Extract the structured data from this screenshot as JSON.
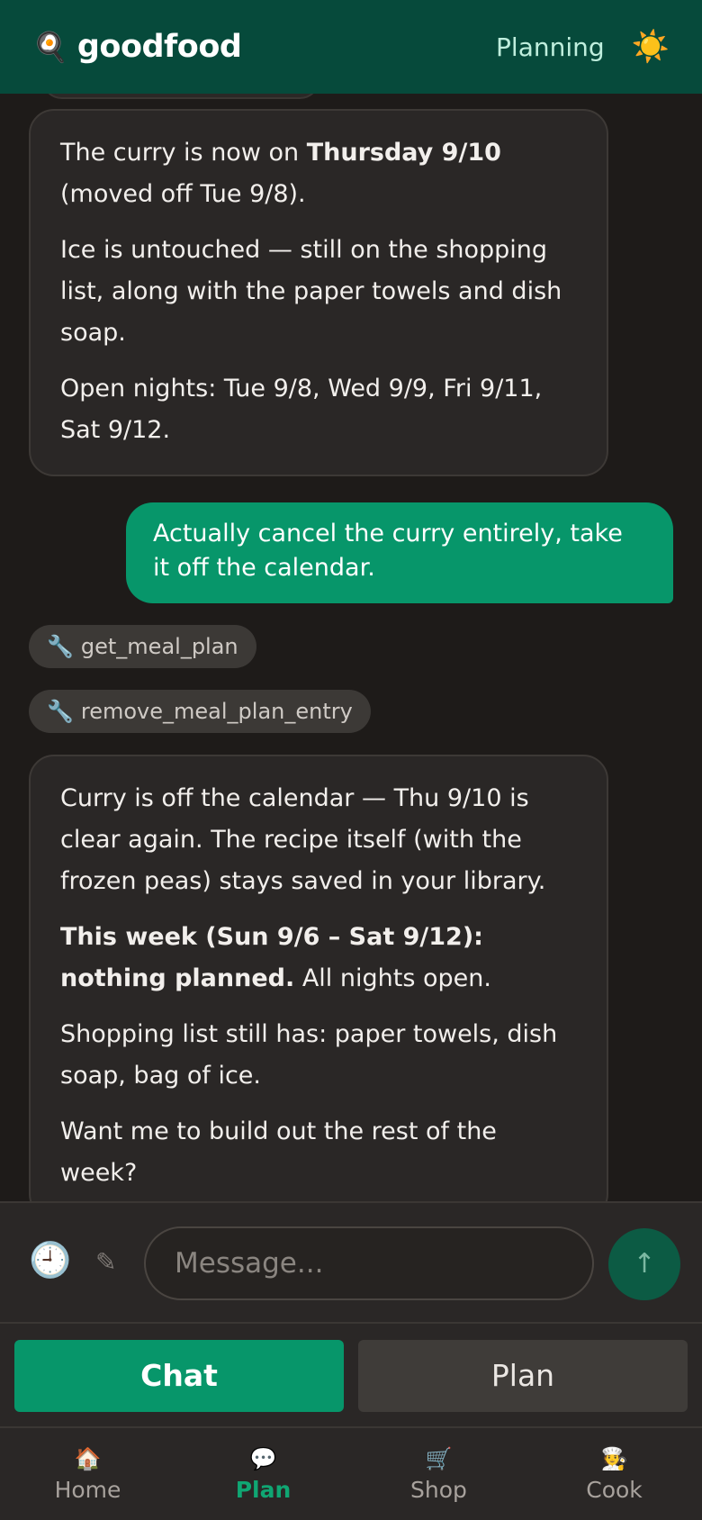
{
  "header": {
    "logo_icon": "🍳",
    "app_name": "goodfood",
    "planning_label": "Planning",
    "theme_icon": "☀️"
  },
  "messages": {
    "ai1": {
      "p1_prefix": "The curry is now on ",
      "p1_bold": "Thursday 9/10",
      "p1_suffix": " (moved off Tue 9/8).",
      "p2": "Ice is untouched — still on the shopping list, along with the paper towels and dish soap.",
      "p3": "Open nights: Tue 9/8, Wed 9/9, Fri 9/11, Sat 9/12."
    },
    "user1": "Actually cancel the curry entirely, take it off the calendar.",
    "tool1": {
      "icon": "🔧",
      "label": "get_meal_plan"
    },
    "tool2": {
      "icon": "🔧",
      "label": "remove_meal_plan_entry"
    },
    "ai2": {
      "p1": "Curry is off the calendar — Thu 9/10 is clear again. The recipe itself (with the frozen peas) stays saved in your library.",
      "p2_bold": "This week (Sun 9/6 – Sat 9/12): nothing planned.",
      "p2_suffix": " All nights open.",
      "p3": "Shopping list still has: paper towels, dish soap, bag of ice.",
      "p4": "Want me to build out the rest of the week?"
    }
  },
  "composer": {
    "history_icon": "🕘",
    "edit_icon": "✎",
    "placeholder": "Message...",
    "send_icon": "↑"
  },
  "mode_toggle": {
    "chat_label": "Chat",
    "plan_label": "Plan"
  },
  "bottom_nav": {
    "items": [
      {
        "icon": "🏠",
        "label": "Home"
      },
      {
        "icon": "💬",
        "label": "Plan"
      },
      {
        "icon": "🛒",
        "label": "Shop"
      },
      {
        "icon": "🧑‍🍳",
        "label": "Cook"
      }
    ]
  },
  "colors": {
    "header_bg": "#064a3b",
    "accent": "#07966a",
    "background": "#1e1b19"
  }
}
